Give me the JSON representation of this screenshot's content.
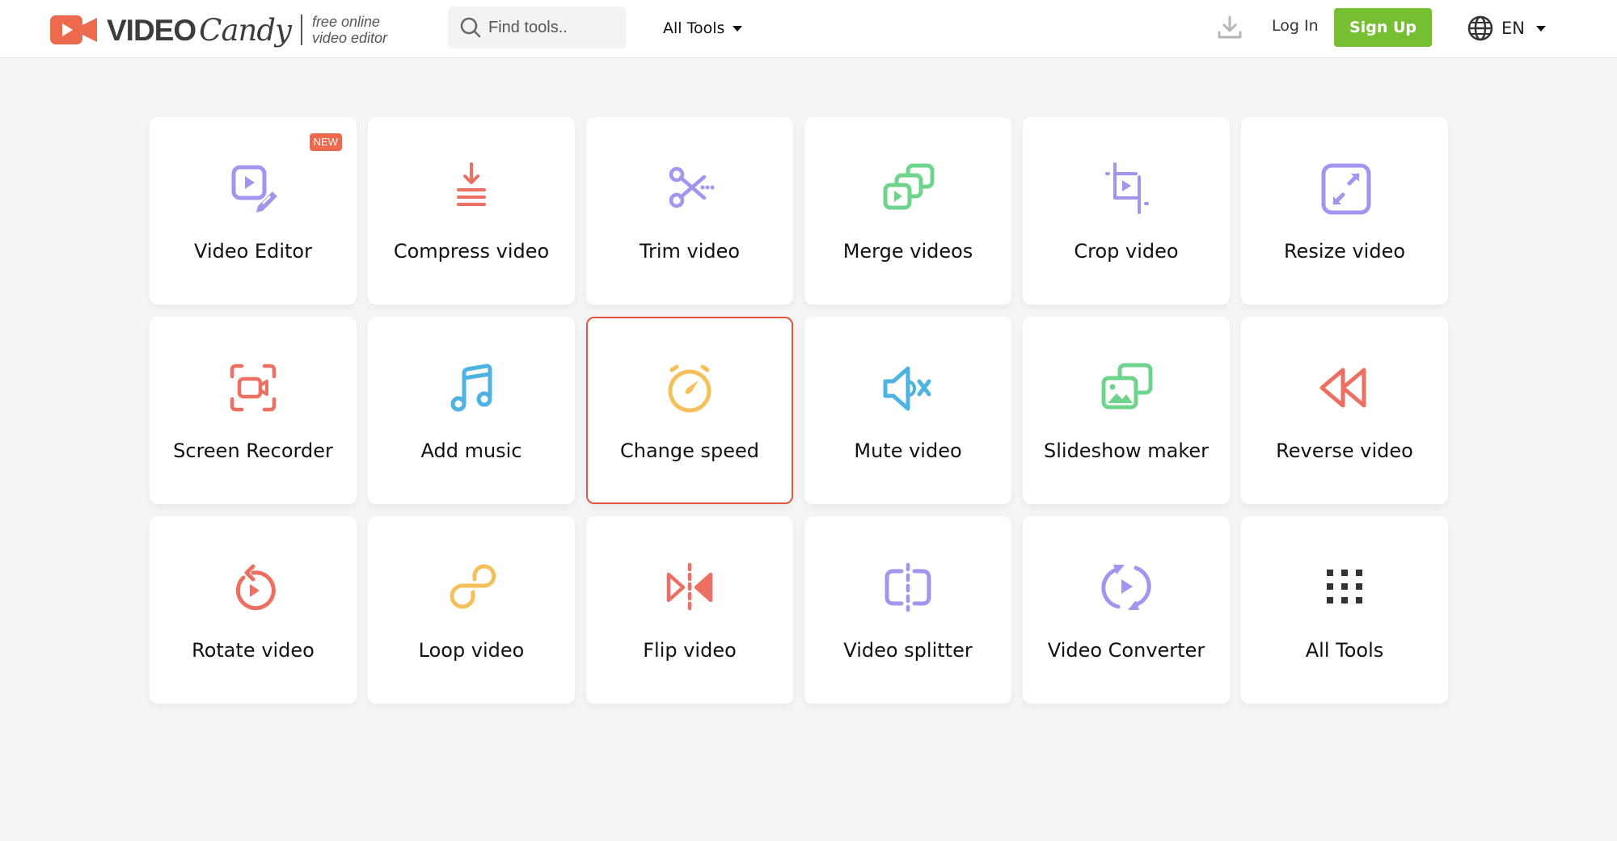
{
  "header": {
    "logo": {
      "word1": "VIDEO",
      "word2": "Candy",
      "tagline_line1": "free online",
      "tagline_line2": "video editor",
      "accent_color": "#ee6a4f"
    },
    "search": {
      "placeholder": "Find tools..",
      "value": "",
      "icon": "search-icon"
    },
    "all_tools_label": "All Tools",
    "download_icon": "download-icon",
    "login_label": "Log In",
    "signup_label": "Sign Up",
    "signup_color": "#76bf32",
    "language": {
      "icon": "globe-icon",
      "selected": "EN"
    }
  },
  "tools": [
    {
      "label": "Video Editor",
      "icon": "video-edit-icon",
      "color": "#a195f0",
      "badge": "NEW"
    },
    {
      "label": "Compress video",
      "icon": "compress-icon",
      "color": "#ec6f62"
    },
    {
      "label": "Trim video",
      "icon": "scissors-icon",
      "color": "#a195f0"
    },
    {
      "label": "Merge videos",
      "icon": "merge-icon",
      "color": "#6fd48b"
    },
    {
      "label": "Crop video",
      "icon": "crop-icon",
      "color": "#a195f0"
    },
    {
      "label": "Resize video",
      "icon": "resize-icon",
      "color": "#a195f0"
    },
    {
      "label": "Screen Recorder",
      "icon": "screen-record-icon",
      "color": "#ec6f62"
    },
    {
      "label": "Add music",
      "icon": "music-note-icon",
      "color": "#4cb3e3"
    },
    {
      "label": "Change speed",
      "icon": "stopwatch-icon",
      "color": "#f5c05a",
      "selected": true
    },
    {
      "label": "Mute video",
      "icon": "mute-icon",
      "color": "#4cb3e3"
    },
    {
      "label": "Slideshow maker",
      "icon": "slideshow-icon",
      "color": "#6fd48b"
    },
    {
      "label": "Reverse video",
      "icon": "rewind-icon",
      "color": "#ec6f62"
    },
    {
      "label": "Rotate video",
      "icon": "rotate-icon",
      "color": "#ec6f62"
    },
    {
      "label": "Loop video",
      "icon": "loop-icon",
      "color": "#f5c05a"
    },
    {
      "label": "Flip video",
      "icon": "flip-icon",
      "color": "#ec6f62"
    },
    {
      "label": "Video splitter",
      "icon": "split-icon",
      "color": "#a195f0"
    },
    {
      "label": "Video Converter",
      "icon": "convert-icon",
      "color": "#a195f0"
    },
    {
      "label": "All Tools",
      "icon": "grid-icon",
      "color": "#333333"
    }
  ]
}
